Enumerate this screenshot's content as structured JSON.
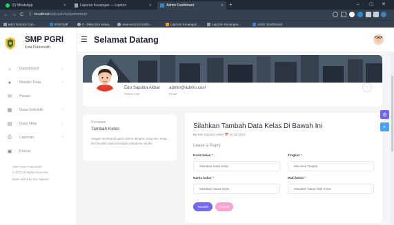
{
  "browser": {
    "tabs": [
      {
        "label": "(2) WhatsApp"
      },
      {
        "label": "Laporan Keuangan — Laptom"
      },
      {
        "label": "Admin Dashboard"
      }
    ],
    "url_host": "localhost",
    "url_path": "/sekolah/kelas/tambah",
    "bookmarks": [
      "5dc3 Nortoon Cari...",
      "BAB Epdf",
      "5 - Deity Den Setya...",
      "view-source:localho...",
      "Laporan Keuangan...",
      "Laporan Keuangan...",
      "Admin Dashboard"
    ]
  },
  "sidebar": {
    "brand": "SMP PGRI",
    "brand_sub": "Kota Prabumulih",
    "items": [
      {
        "label": "Dashboard",
        "icon": "home-icon",
        "chevron": true
      },
      {
        "label": "Master Data",
        "icon": "database-icon",
        "chevron": true
      },
      {
        "label": "Pesan",
        "icon": "message-icon",
        "chevron": false
      },
      {
        "label": "Data Sekolah",
        "icon": "school-icon",
        "chevron": true
      },
      {
        "label": "Data Nilai",
        "icon": "document-icon",
        "chevron": true
      },
      {
        "label": "Laporan",
        "icon": "printer-icon",
        "chevron": true
      },
      {
        "label": "Keluar",
        "icon": "logout-icon",
        "chevron": false
      }
    ],
    "footer": {
      "line1": "SMP PGRI Prabumulih",
      "line2": "© 2023 All Rights Reserved",
      "line3": "Made with ♥ by Edo Saputra"
    }
  },
  "header": {
    "title": "Selamat Datang"
  },
  "profile": {
    "name": "Edo Saputra Akbar",
    "name_label": "Nama User",
    "email": "admin@admin.com",
    "email_label": "Email",
    "more": "···"
  },
  "note": {
    "heading": "Perhatian",
    "title": "Tambah Kelas",
    "body": "Jangan membandingkan dirimu dengan orang lain, tetap berfokuslah pada kemajuan pribadimu sendiri."
  },
  "form": {
    "title": "Silahkan Tambah Data Kelas Di Bawah Ini",
    "meta": "By Edo Saputra Akbar  📅 20 Jul 2023",
    "subtitle": "Leave a Reply",
    "fields": {
      "kode": {
        "label": "Kode kelas",
        "placeholder": "Masukan Kode kelas"
      },
      "tingkat": {
        "label": "Tingkat",
        "placeholder": "Masukan Tingkat"
      },
      "nama": {
        "label": "Nama kelas",
        "placeholder": "Masukan Nama kelas"
      },
      "wali": {
        "label": "Wali kelas",
        "placeholder": "Masukan Nama Wali Kelas"
      }
    },
    "submit_label": "Tambah",
    "cancel_label": "Cancel"
  },
  "colors": {
    "accent": "#7367f0",
    "cancel": "#f8a5d2",
    "browser_dark": "#1f2a36"
  }
}
